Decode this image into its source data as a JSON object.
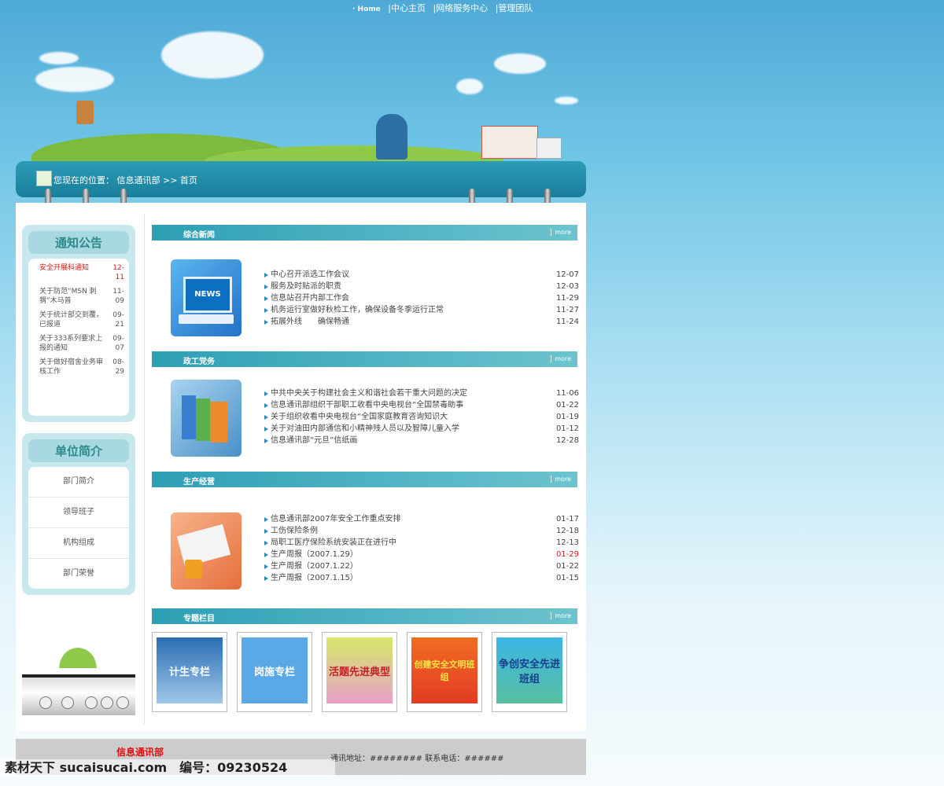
{
  "topnav": [
    "· Home",
    "|中心主页",
    "|网络服务中心",
    "|管理团队"
  ],
  "banner": {
    "location": "您现在的位置： 信息通讯部 >> 首页"
  },
  "notice": {
    "title": "通知公告",
    "items": [
      {
        "text": "安全开展科通知",
        "date": "12-11",
        "highlight": true
      },
      {
        "text": "关于防范“MSN 刺猬”木马普",
        "date": "11-09",
        "highlight": false
      },
      {
        "text": "关于统计部交到覆，已报道",
        "date": "09-21",
        "highlight": false
      },
      {
        "text": "关于333系列要求上报的通知",
        "date": "09-07",
        "highlight": false
      },
      {
        "text": "关于做好宿舍业务审核工作",
        "date": "08-29",
        "highlight": false
      }
    ]
  },
  "units": {
    "title": "单位简介",
    "items": [
      "部门简介",
      "领导班子",
      "机构组成",
      "部门荣誉"
    ]
  },
  "sections": [
    {
      "title": "综合新闻",
      "more": "more",
      "icon": "news-icon",
      "items": [
        {
          "text": "中心召开派选工作会议",
          "date": "12-07",
          "red": false
        },
        {
          "text": "服务及时贴派的职责",
          "date": "12-03",
          "red": false
        },
        {
          "text": "信息站召开内部工作会",
          "date": "11-29",
          "red": false
        },
        {
          "text": "机务运行室做好秋检工作，确保设备冬季运行正常",
          "date": "11-27",
          "red": false
        },
        {
          "text": "拓展外线　　确保畅通",
          "date": "11-24",
          "red": false
        }
      ]
    },
    {
      "title": "政工党务",
      "more": "more",
      "icon": "books-icon",
      "items": [
        {
          "text": "中共中央关于构建社会主义和谐社会若干重大问题的决定",
          "date": "11-06",
          "red": false
        },
        {
          "text": "信息通讯部组织干部职工收看中央电视台“全国禁毒助事",
          "date": "01-22",
          "red": false
        },
        {
          "text": "关于组织收看中央电视台“全国家庭教育咨询知识大",
          "date": "01-19",
          "red": false
        },
        {
          "text": "关于对油田内部通信和小精神残人员以及智障儿童入学",
          "date": "01-12",
          "red": false
        },
        {
          "text": "信息通讯部“元旦”信纸画",
          "date": "12-28",
          "red": false
        }
      ]
    },
    {
      "title": "生产经营",
      "more": "more",
      "icon": "documents-icon",
      "items": [
        {
          "text": "信息通讯部2007年安全工作重点安排",
          "date": "01-17",
          "red": false
        },
        {
          "text": "工伤保险条例",
          "date": "12-18",
          "red": false
        },
        {
          "text": "局职工医疗保险系统安装正在进行中",
          "date": "12-13",
          "red": false
        },
        {
          "text": "生产周报（2007.1.29）",
          "date": "01-29",
          "red": true
        },
        {
          "text": "生产周报（2007.1.22）",
          "date": "01-22",
          "red": false
        },
        {
          "text": "生产周报（2007.1.15）",
          "date": "01-15",
          "red": false
        }
      ]
    }
  ],
  "special": {
    "title": "专题栏目",
    "more": "more",
    "items": [
      "计生专栏",
      "岗施专栏",
      "活题先进典型",
      "创建安全文明班组",
      "争创安全先进班组"
    ]
  },
  "footer": {
    "logo": "信息通讯部",
    "address": "通讯地址：######## 联系电话：######"
  },
  "watermark": "素材天下 sucaisucai.com　编号：09230524"
}
